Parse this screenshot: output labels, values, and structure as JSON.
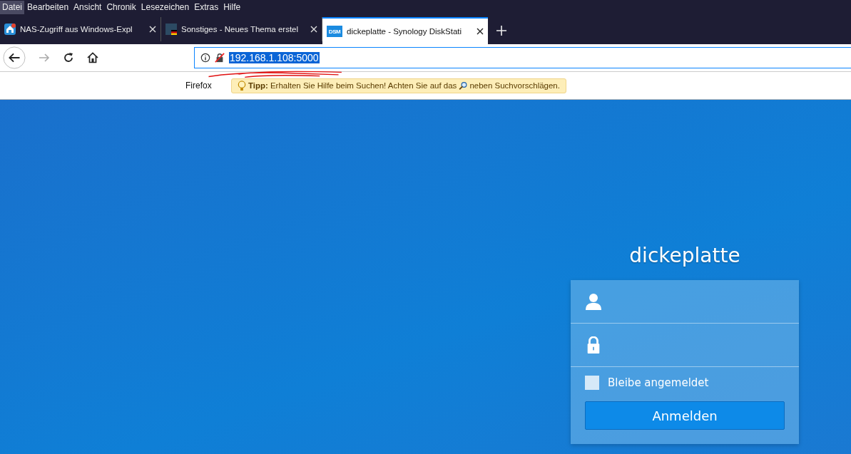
{
  "menu": [
    {
      "label": "Datei",
      "selected": true
    },
    {
      "label": "Bearbeiten",
      "selected": false
    },
    {
      "label": "Ansicht",
      "selected": false
    },
    {
      "label": "Chronik",
      "selected": false
    },
    {
      "label": "Lesezeichen",
      "selected": false
    },
    {
      "label": "Extras",
      "selected": false
    },
    {
      "label": "Hilfe",
      "selected": false
    }
  ],
  "tabs": [
    {
      "title": "NAS-Zugriff aus Windows-Expl",
      "selected": false,
      "kind": "house"
    },
    {
      "title": "Sonstiges - Neues Thema erstel",
      "selected": false,
      "kind": "forum"
    },
    {
      "title": "dickeplatte - Synology DiskStati",
      "selected": true,
      "kind": "dsm",
      "icon_text": "DSM"
    }
  ],
  "address_bar": {
    "url": "192.168.1.108:5000",
    "selected": true
  },
  "suggestion": {
    "engine": "Firefox",
    "tip_label": "Tipp:",
    "tip_text": "Erhalten Sie Hilfe beim Suchen! Achten Sie auf das",
    "tip_end": "neben Suchvorschlägen."
  },
  "login": {
    "hostname": "dickeplatte",
    "remember": {
      "label": "Bleibe angemeldet",
      "checked": false
    },
    "button": "Anmelden"
  }
}
